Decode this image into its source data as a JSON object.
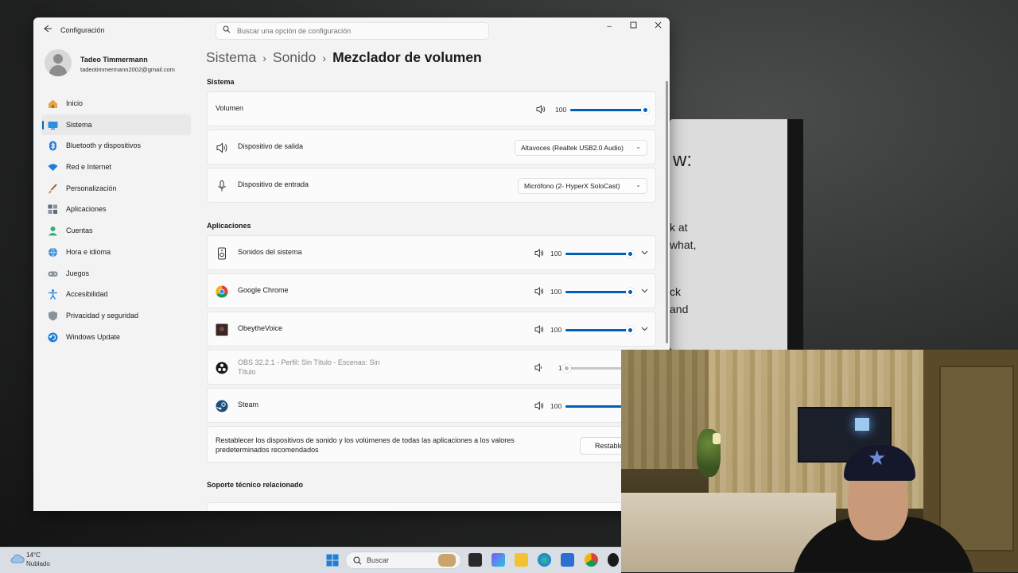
{
  "window": {
    "app_title": "Configuración",
    "search_placeholder": "Buscar una opción de configuración"
  },
  "profile": {
    "name": "Tadeo Timmermann",
    "email": "tadeotimmermann2002@gmail.com"
  },
  "nav": [
    {
      "label": "Inicio",
      "icon": "home-icon",
      "active": false
    },
    {
      "label": "Sistema",
      "icon": "system-icon",
      "active": true
    },
    {
      "label": "Bluetooth y dispositivos",
      "icon": "bluetooth-icon",
      "active": false
    },
    {
      "label": "Red e Internet",
      "icon": "wifi-icon",
      "active": false
    },
    {
      "label": "Personalización",
      "icon": "brush-icon",
      "active": false
    },
    {
      "label": "Aplicaciones",
      "icon": "apps-icon",
      "active": false
    },
    {
      "label": "Cuentas",
      "icon": "account-icon",
      "active": false
    },
    {
      "label": "Hora e idioma",
      "icon": "globe-icon",
      "active": false
    },
    {
      "label": "Juegos",
      "icon": "gamepad-icon",
      "active": false
    },
    {
      "label": "Accesibilidad",
      "icon": "accessibility-icon",
      "active": false
    },
    {
      "label": "Privacidad y seguridad",
      "icon": "shield-icon",
      "active": false
    },
    {
      "label": "Windows Update",
      "icon": "update-icon",
      "active": false
    }
  ],
  "breadcrumb": {
    "part1": "Sistema",
    "part2": "Sonido",
    "part3": "Mezclador de volumen",
    "sep": "›"
  },
  "system_section": {
    "title": "Sistema",
    "volume_label": "Volumen",
    "volume_value": "100",
    "volume_level": 1.0,
    "output_label": "Dispositivo de salida",
    "output_value": "Altavoces (Realtek USB2.0 Audio)",
    "input_label": "Dispositivo de entrada",
    "input_value": "Micrófono (2- HyperX SoloCast)"
  },
  "apps_section": {
    "title": "Aplicaciones",
    "apps": [
      {
        "name": "Sonidos del sistema",
        "value": "100",
        "level": 1.0,
        "icon": "system-sounds-icon"
      },
      {
        "name": "Google Chrome",
        "value": "100",
        "level": 1.0,
        "icon": "chrome-icon"
      },
      {
        "name": "ObeytheVoice",
        "value": "100",
        "level": 1.0,
        "icon": "obeythevoice-icon"
      },
      {
        "name": "OBS 32.2.1 - Perfil: Sin Título - Escenas: Sin Título",
        "value": "1",
        "level": 0.01,
        "icon": "obs-icon"
      },
      {
        "name": "Steam",
        "value": "100",
        "level": 1.0,
        "icon": "steam-icon"
      }
    ],
    "reset_text": "Restablecer los dispositivos de sonido y los volúmenes de todas las aplicaciones a los valores predeterminados recomendados",
    "reset_button": "Restable"
  },
  "support_section": {
    "title": "Soporte técnico relacionado"
  },
  "background_text": [
    "w:",
    "k at",
    "what,",
    "ck",
    "and"
  ],
  "taskbar": {
    "temperature": "14°C",
    "condition": "Nublado",
    "search_label": "Buscar"
  },
  "colors": {
    "accent": "#005fb8",
    "window_bg": "#f3f3f3",
    "card_bg": "#fbfbfb",
    "taskbar_bg": "#d9dde4"
  }
}
